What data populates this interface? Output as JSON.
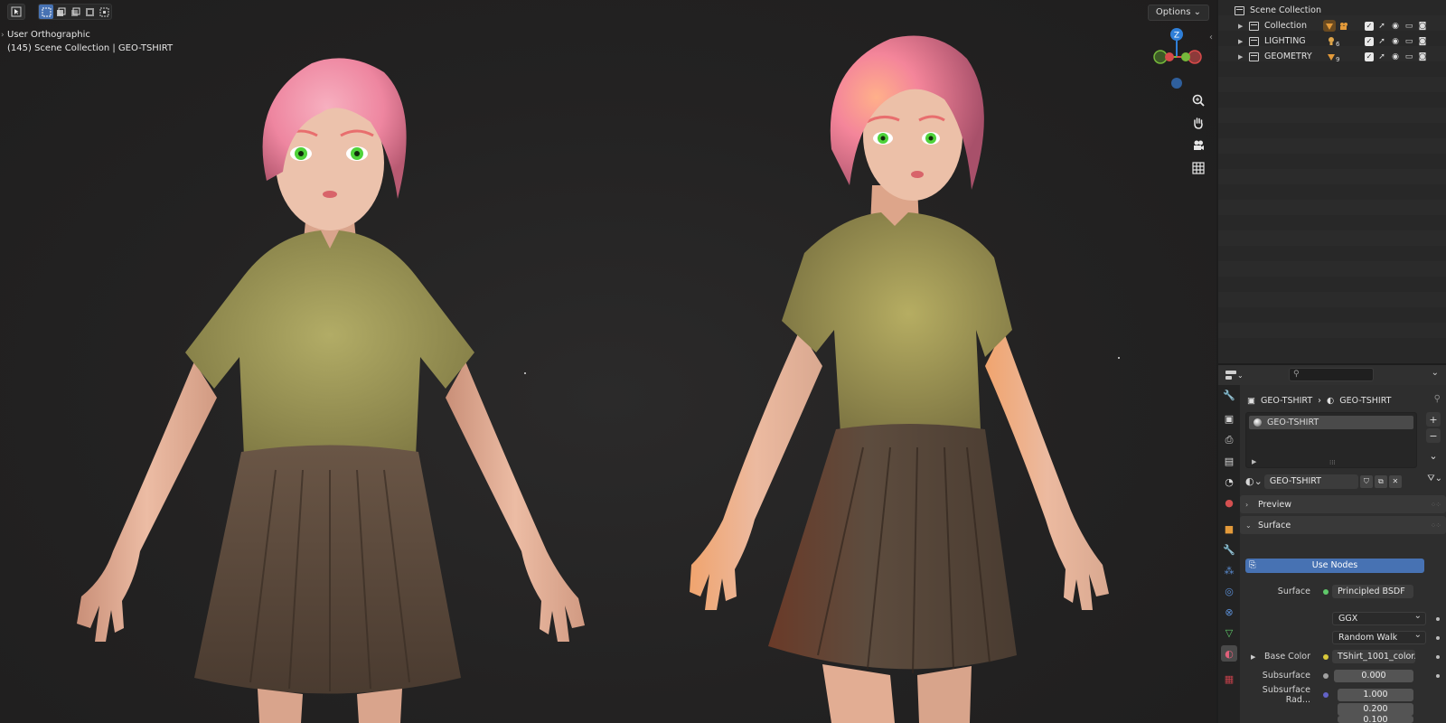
{
  "viewport": {
    "options_label": "Options",
    "view_name": "User Orthographic",
    "context_line": "(145) Scene Collection | GEO-TSHIRT",
    "gizmo_z_label": "Z"
  },
  "outliner": {
    "root_label": "Scene Collection",
    "collections": [
      {
        "label": "Collection",
        "badge": "2"
      },
      {
        "label": "LIGHTING",
        "badge": "6"
      },
      {
        "label": "GEOMETRY",
        "badge": "9"
      }
    ]
  },
  "properties": {
    "search_placeholder": "",
    "breadcrumb_object": "GEO-TSHIRT",
    "breadcrumb_material": "GEO-TSHIRT",
    "slot_name": "GEO-TSHIRT",
    "material_name": "GEO-TSHIRT",
    "panels": {
      "preview": "Preview",
      "surface": "Surface"
    },
    "use_nodes_label": "Use Nodes",
    "surface_label": "Surface",
    "surface_value": "Principled BSDF",
    "distribution": "GGX",
    "subsurface_method": "Random Walk",
    "base_color_label": "Base Color",
    "base_color_value": "TShirt_1001_color.j...",
    "subsurface_label": "Subsurface",
    "subsurface_value": "0.000",
    "subsurface_radius_label": "Subsurface Rad...",
    "subsurface_radius": [
      "1.000",
      "0.200",
      "0.100"
    ]
  },
  "colors": {
    "accent_blue": "#4772b3",
    "hair": "#f08fa8",
    "shirt": "#a9a25c",
    "skirt": "#5d4c3e",
    "skin": "#e8b8a0",
    "eyes": "#4fd23a"
  }
}
